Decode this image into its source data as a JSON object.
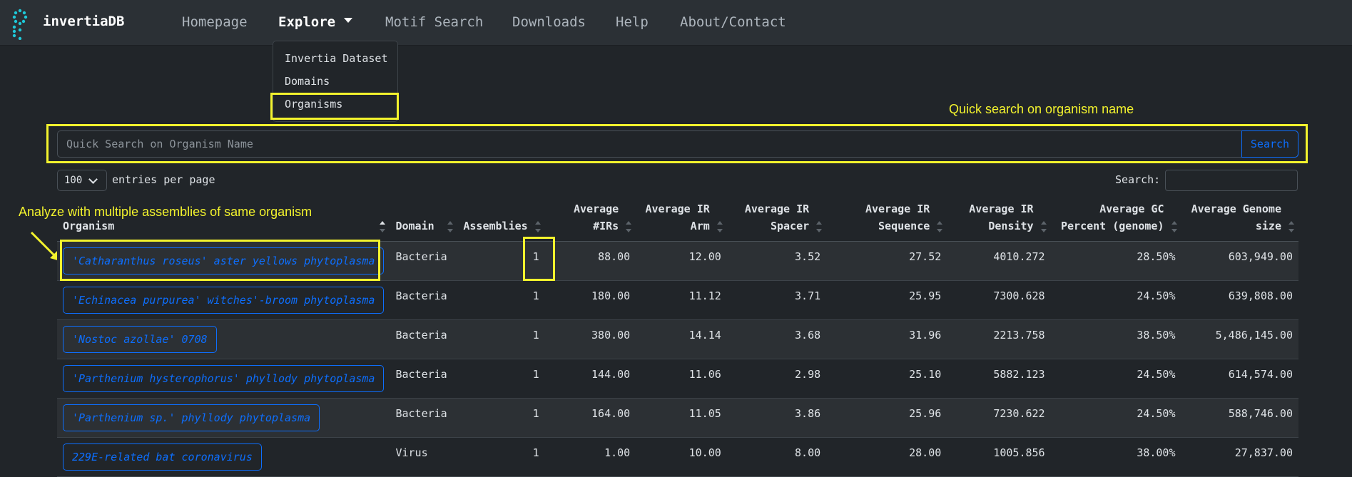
{
  "brand": {
    "name": "invertiaDB",
    "accent": "#1ec8d8"
  },
  "nav": {
    "items": [
      {
        "label": "Homepage"
      },
      {
        "label": "Explore"
      },
      {
        "label": "Motif Search"
      },
      {
        "label": "Downloads"
      },
      {
        "label": "Help"
      },
      {
        "label": "About/Contact"
      }
    ],
    "dropdown": [
      "Invertia Dataset",
      "Domains",
      "Organisms"
    ]
  },
  "annotations": {
    "quick_search": "Quick search on organism name",
    "multiple_assemblies": "Analyze with multiple assemblies of same organism",
    "color": "#f3f32d"
  },
  "search": {
    "placeholder": "Quick Search on Organism Name",
    "button": "Search"
  },
  "table_controls": {
    "page_length": "100",
    "length_label": "entries per page",
    "filter_label": "Search:"
  },
  "table": {
    "headers": [
      [
        "Organism"
      ],
      [
        "Domain"
      ],
      [
        "Assemblies"
      ],
      [
        "Average",
        "#IRs"
      ],
      [
        "Average IR",
        "Arm"
      ],
      [
        "Average IR",
        "Spacer"
      ],
      [
        "Average IR",
        "Sequence"
      ],
      [
        "Average IR",
        "Density"
      ],
      [
        "Average GC",
        "Percent (genome)"
      ],
      [
        "Average Genome",
        "size"
      ]
    ],
    "rows": [
      [
        "'Catharanthus roseus' aster yellows phytoplasma",
        "Bacteria",
        "1",
        "88.00",
        "12.00",
        "3.52",
        "27.52",
        "4010.272",
        "28.50%",
        "603,949.00"
      ],
      [
        "'Echinacea purpurea' witches'-broom phytoplasma",
        "Bacteria",
        "1",
        "180.00",
        "11.12",
        "3.71",
        "25.95",
        "7300.628",
        "24.50%",
        "639,808.00"
      ],
      [
        "'Nostoc azollae' 0708",
        "Bacteria",
        "1",
        "380.00",
        "14.14",
        "3.68",
        "31.96",
        "2213.758",
        "38.50%",
        "5,486,145.00"
      ],
      [
        "'Parthenium hysterophorus' phyllody phytoplasma",
        "Bacteria",
        "1",
        "144.00",
        "11.06",
        "2.98",
        "25.10",
        "5882.123",
        "24.50%",
        "614,574.00"
      ],
      [
        "'Parthenium sp.' phyllody phytoplasma",
        "Bacteria",
        "1",
        "164.00",
        "11.05",
        "3.86",
        "25.96",
        "7230.622",
        "24.50%",
        "588,746.00"
      ],
      [
        "229E-related bat coronavirus",
        "Virus",
        "1",
        "1.00",
        "10.00",
        "8.00",
        "28.00",
        "1005.856",
        "38.00%",
        "27,837.00"
      ]
    ]
  }
}
